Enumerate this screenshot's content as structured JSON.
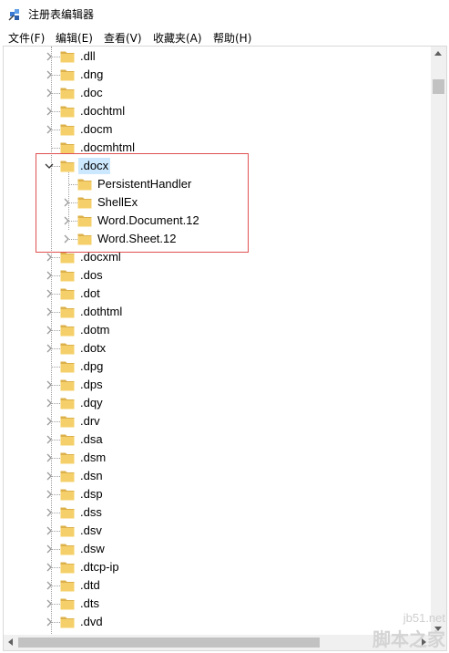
{
  "window": {
    "title": "注册表编辑器"
  },
  "menu": [
    {
      "label": "文件(F)"
    },
    {
      "label": "编辑(E)"
    },
    {
      "label": "查看(V)"
    },
    {
      "label": "收藏夹(A)"
    },
    {
      "label": "帮助(H)"
    }
  ],
  "tree": [
    {
      "label": ".dll",
      "level": 0,
      "expandable": true
    },
    {
      "label": ".dng",
      "level": 0,
      "expandable": true
    },
    {
      "label": ".doc",
      "level": 0,
      "expandable": true
    },
    {
      "label": ".dochtml",
      "level": 0,
      "expandable": true
    },
    {
      "label": ".docm",
      "level": 0,
      "expandable": true
    },
    {
      "label": ".docmhtml",
      "level": 0,
      "expandable": false
    },
    {
      "label": ".docx",
      "level": 0,
      "expandable": true,
      "expanded": true,
      "selected": true
    },
    {
      "label": "PersistentHandler",
      "level": 1,
      "expandable": false
    },
    {
      "label": "ShellEx",
      "level": 1,
      "expandable": true
    },
    {
      "label": "Word.Document.12",
      "level": 1,
      "expandable": true
    },
    {
      "label": "Word.Sheet.12",
      "level": 1,
      "expandable": true
    },
    {
      "label": ".docxml",
      "level": 0,
      "expandable": true
    },
    {
      "label": ".dos",
      "level": 0,
      "expandable": true
    },
    {
      "label": ".dot",
      "level": 0,
      "expandable": true
    },
    {
      "label": ".dothtml",
      "level": 0,
      "expandable": true
    },
    {
      "label": ".dotm",
      "level": 0,
      "expandable": true
    },
    {
      "label": ".dotx",
      "level": 0,
      "expandable": true
    },
    {
      "label": ".dpg",
      "level": 0,
      "expandable": false
    },
    {
      "label": ".dps",
      "level": 0,
      "expandable": true
    },
    {
      "label": ".dqy",
      "level": 0,
      "expandable": true
    },
    {
      "label": ".drv",
      "level": 0,
      "expandable": true
    },
    {
      "label": ".dsa",
      "level": 0,
      "expandable": true
    },
    {
      "label": ".dsm",
      "level": 0,
      "expandable": true
    },
    {
      "label": ".dsn",
      "level": 0,
      "expandable": true
    },
    {
      "label": ".dsp",
      "level": 0,
      "expandable": true
    },
    {
      "label": ".dss",
      "level": 0,
      "expandable": true
    },
    {
      "label": ".dsv",
      "level": 0,
      "expandable": true
    },
    {
      "label": ".dsw",
      "level": 0,
      "expandable": true
    },
    {
      "label": ".dtcp-ip",
      "level": 0,
      "expandable": true
    },
    {
      "label": ".dtd",
      "level": 0,
      "expandable": true
    },
    {
      "label": ".dts",
      "level": 0,
      "expandable": true
    },
    {
      "label": ".dvd",
      "level": 0,
      "expandable": true
    }
  ],
  "watermark": {
    "site": "jb51.net",
    "brand": "脚本之家"
  },
  "colors": {
    "folder": "#f5d06a",
    "folder_dark": "#dcb04a",
    "selection": "#cce8ff",
    "highlight_box": "#e05050"
  }
}
